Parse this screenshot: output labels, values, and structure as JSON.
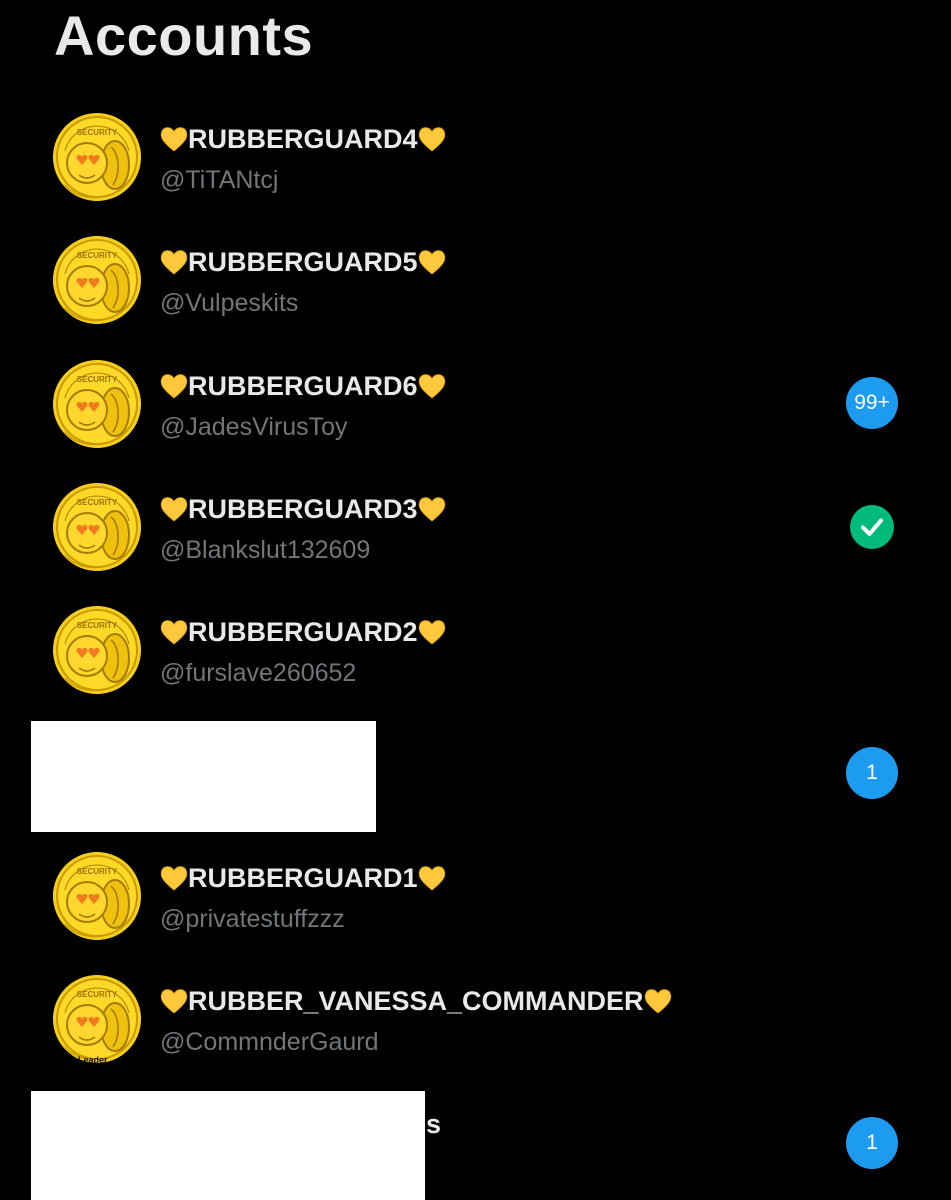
{
  "page": {
    "title": "Accounts"
  },
  "icons": {
    "heart": "yellow-heart-emoji",
    "avatar": "gold-coin-avatar",
    "check": "check-icon"
  },
  "colors": {
    "background": "#000000",
    "primary_text": "#e7e9ea",
    "secondary_text": "#71767b",
    "badge_blue": "#1d9bf0",
    "badge_green": "#00ba7c",
    "heart_yellow": "#ffc83d"
  },
  "accounts": [
    {
      "name": "RUBBERGUARD4",
      "handle": "@TiTANtcj"
    },
    {
      "name": "RUBBERGUARD5",
      "handle": "@Vulpeskits"
    },
    {
      "name": "RUBBERGUARD6",
      "handle": "@JadesVirusToy",
      "badge": "99+"
    },
    {
      "name": "RUBBERGUARD3",
      "handle": "@Blankslut132609",
      "active": true
    },
    {
      "name": "RUBBERGUARD2",
      "handle": "@furslave260652"
    },
    {
      "redacted": true,
      "badge": "1"
    },
    {
      "name": "RUBBERGUARD1",
      "handle": "@privatestuffzzz"
    },
    {
      "name": "RUBBER_VANESSA_COMMANDER",
      "handle": "@CommnderGaurd",
      "avatar_caption": "Leader"
    },
    {
      "redacted": true,
      "visible_text": "s",
      "badge": "1"
    }
  ]
}
